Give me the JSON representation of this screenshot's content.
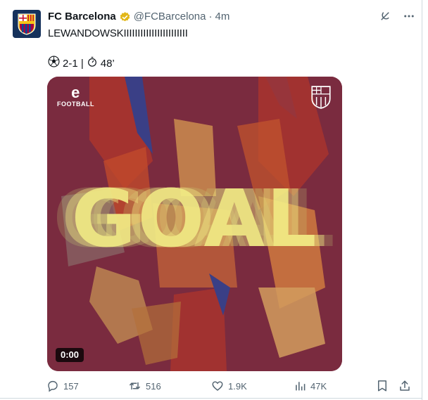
{
  "tweet": {
    "author_name": "FC Barcelona",
    "handle": "@FCBarcelona",
    "separator": "·",
    "time": "4m",
    "text": "LEWANDOWSKIIIIIIIIIIIIIIIIIIIIIII",
    "score": "2-1 |",
    "minute": "48’"
  },
  "media": {
    "brand_label": "FOOTBALL",
    "brand_letter": "e",
    "headline": "GOAL",
    "duration": "0:00"
  },
  "actions": {
    "replies": "157",
    "reposts": "516",
    "likes": "1.9K",
    "views": "47K"
  },
  "colors": {
    "media_bg": "#7a2b3f",
    "goal_yellow": "#f3ee86",
    "barca_blue": "#16325c",
    "muted_text": "#536471"
  },
  "icons": [
    "verified-badge-icon",
    "grok-icon",
    "more-icon",
    "soccer-ball-icon",
    "stopwatch-icon",
    "reply-icon",
    "repost-icon",
    "like-icon",
    "views-icon",
    "bookmark-icon",
    "share-icon"
  ]
}
